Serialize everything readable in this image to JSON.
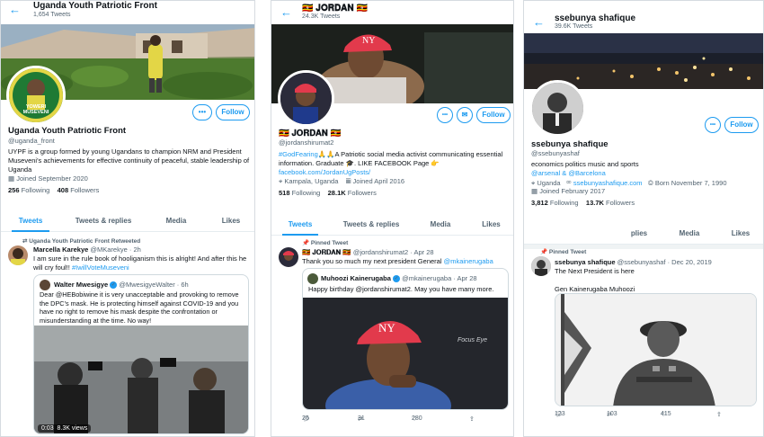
{
  "panel1": {
    "title": "Uganda Youth Patriotic Front",
    "tweet_count": "1,654 Tweets",
    "avatar_text": "YOWERI MUSEVENI",
    "more_label": "•••",
    "follow_label": "Follow",
    "display_name": "Uganda Youth Patriotic Front",
    "handle": "@uganda_front",
    "bio": "UYPF is a group formed by young Ugandans to champion NRM and President Museveni's achievements for effective continuity of peaceful, stable leadership of Uganda",
    "joined": "Joined September 2020",
    "following_count": "256",
    "following_label": "Following",
    "followers_count": "408",
    "followers_label": "Followers",
    "tabs": [
      "Tweets",
      "Tweets & replies",
      "Media",
      "Likes"
    ],
    "retweet_note": "Uganda Youth Patriotic Front Retweeted",
    "tweet": {
      "name": "Marcella Karekye",
      "handle": "@MKarekye",
      "time": "· 2h",
      "text": "I am sure in the rule book of hooliganism this is alright! And after this he will cry foul!!",
      "hashtag": "#IwillVoteMuseveni",
      "quote_name": "Walter Mwesigye",
      "quote_handle": "@MwesigyeWalter · 6h",
      "quote_text": "Dear @HEBobiwine it is very unacceptable and provoking to remove the DPC's mask. He is protecting himself against COVID-19 and you have no right to remove his mask despite the confrontation or misunderstanding at the time. No way!",
      "video_time": "0:03",
      "video_views": "8.3K views"
    }
  },
  "panel2": {
    "title": "🇺🇬 𝐉𝐎𝐑𝐃𝐀𝐍 🇺🇬",
    "tweet_count": "24.3K Tweets",
    "more_label": "•••",
    "mail_label": "✉",
    "follow_label": "Follow",
    "display_name": "🇺🇬 𝐉𝐎𝐑𝐃𝐀𝐍 🇺🇬",
    "handle": "@jordanshirumat2",
    "bio_hashtag": "#GodFearing🙏🙏",
    "bio": "A Patriotic social media activist communicating essential information. Graduate 🎓. LIKE FACEBOOK Page 👉",
    "bio_link": "facebook.com/JordanUgPosts/",
    "location": "Kampala, Uganda",
    "joined": "Joined April 2016",
    "following_count": "518",
    "following_label": "Following",
    "followers_count": "28.1K",
    "followers_label": "Followers",
    "tabs": [
      "Tweets",
      "Tweets & replies",
      "Media",
      "Likes"
    ],
    "pinned_label": "Pinned Tweet",
    "tweet": {
      "name": "🇺🇬 𝐉𝐎𝐑𝐃𝐀𝐍 🇺🇬",
      "handle": "@jordanshirumat2 · Apr 28",
      "text": "Thank you so much my next president General",
      "mention": "@mkainerugaba",
      "quote_name": "Muhoozi Kainerugaba",
      "quote_handle": "@mkainerugaba · Apr 28",
      "quote_text": "Happy birthday @jordanshirumat2. May you have many more.",
      "photo_caption": "Focus Eye",
      "replies": "26",
      "retweets": "31",
      "likes": "280"
    }
  },
  "panel3": {
    "title": "ssebunya shafique",
    "tweet_count": "39.6K Tweets",
    "more_label": "•••",
    "follow_label": "Follow",
    "display_name": "ssebunya shafique",
    "handle": "@ssebunyashaf",
    "bio": "economics politics music and sports",
    "bio_links": "@arsenal & @Barcelona",
    "location": "Uganda",
    "website": "ssebunyashafique.com",
    "born": "Born November 7, 1990",
    "joined": "Joined February 2017",
    "following_count": "3,812",
    "following_label": "Following",
    "followers_count": "13.7K",
    "followers_label": "Followers",
    "tabs": [
      "plies",
      "Media",
      "Likes"
    ],
    "pinned_label": "Pinned Tweet",
    "tweet": {
      "name": "ssebunya shafique",
      "handle": "@ssebunyashaf · Dec 20, 2019",
      "text1": "The Next President is here",
      "text2": "Gen Kainerugaba Muhoozi",
      "replies": "123",
      "retweets": "103",
      "likes": "415"
    }
  },
  "colors": {
    "accent": "#1d9bf0",
    "text": "#0f1419",
    "muted": "#536471"
  }
}
